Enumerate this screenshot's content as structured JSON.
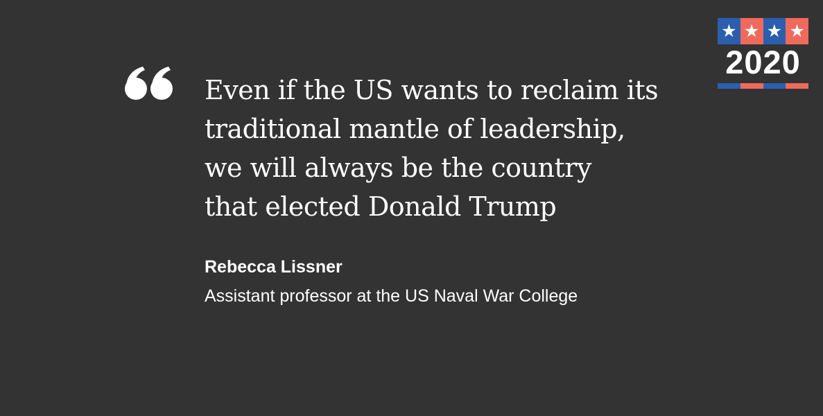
{
  "quote": {
    "lines": [
      "Even if the US wants to reclaim its",
      "traditional mantle of leadership,",
      "we will always be the country",
      "that elected Donald Trump"
    ],
    "icon": "opening-quote-icon"
  },
  "author": {
    "name": "Rebecca Lissner",
    "title": "Assistant professor at the US Naval War College"
  },
  "badge": {
    "stars": [
      "★",
      "★",
      "★",
      "★"
    ],
    "year": "2020"
  },
  "colors": {
    "background": "#333333",
    "text": "#ffffff",
    "badge_blue": "#2b5fad",
    "badge_red": "#ef6a5c"
  }
}
